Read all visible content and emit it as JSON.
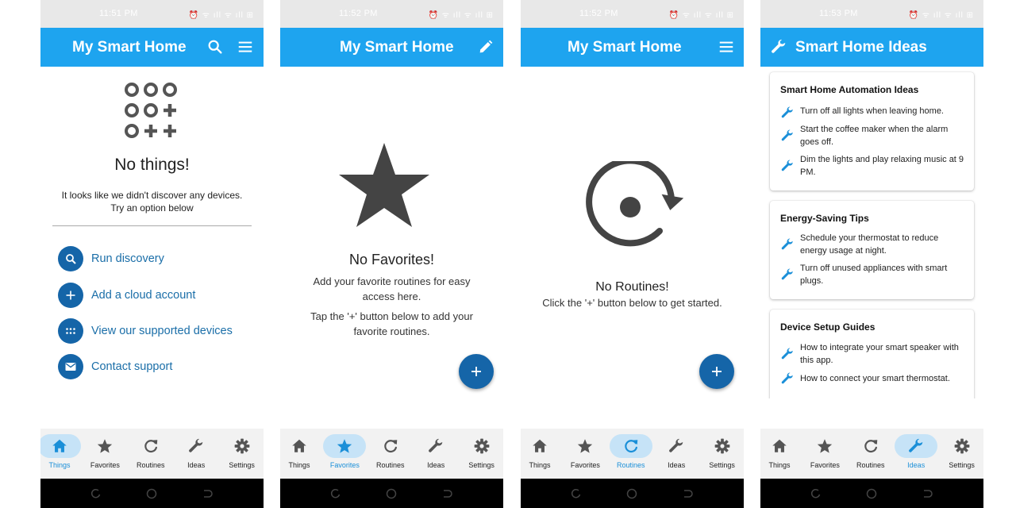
{
  "colors": {
    "primary": "#1ea4ef",
    "accent": "#1565a8",
    "active_nav_pill": "#c6e3f7"
  },
  "screens": [
    {
      "status_time": "11:51 PM",
      "status_icons": "⏰ ᯤ ıll ᯤ ıll ⊞",
      "title": "My Smart Home",
      "actions": [
        "search-icon",
        "menu-icon"
      ],
      "empty": {
        "title": "No things!",
        "line1": "It looks like we didn't discover any devices.",
        "line2": "Try an option below"
      },
      "options": [
        {
          "label": "Run discovery",
          "icon": "search-icon"
        },
        {
          "label": "Add a cloud account",
          "icon": "plus-icon"
        },
        {
          "label": "View our supported devices",
          "icon": "dots-grid-icon"
        },
        {
          "label": "Contact support",
          "icon": "mail-icon"
        }
      ],
      "active_tab": "Things"
    },
    {
      "status_time": "11:52 PM",
      "status_icons": "⏰ ᯤ ıll ᯤ ıll ⊞",
      "title": "My Smart Home",
      "actions": [
        "edit-icon"
      ],
      "empty": {
        "title": "No Favorites!",
        "line1": "Add your favorite routines for easy access here.",
        "line2": "Tap the '+' button below to add your favorite routines."
      },
      "active_tab": "Favorites"
    },
    {
      "status_time": "11:52 PM",
      "status_icons": "⏰ ᯤ ıll ᯤ ıll ⊞",
      "title": "My Smart Home",
      "actions": [
        "menu-icon"
      ],
      "empty": {
        "title": "No Routines!",
        "line1": "Click the '+' button below to get started."
      },
      "active_tab": "Routines"
    },
    {
      "status_time": "11:53 PM",
      "status_icons": "⏰ ᯤ ıll ᯤ ıll ⊞",
      "title": "Smart Home Ideas",
      "title_icon": "wrench-icon",
      "cards": [
        {
          "title": "Smart Home Automation Ideas",
          "items": [
            "Turn off all lights when leaving home.",
            "Start the coffee maker when the alarm goes off.",
            "Dim the lights and play relaxing music at 9 PM."
          ]
        },
        {
          "title": "Energy-Saving Tips",
          "items": [
            "Schedule your thermostat to reduce energy usage at night.",
            "Turn off unused appliances with smart plugs."
          ]
        },
        {
          "title": "Device Setup Guides",
          "items": [
            "How to integrate your smart speaker with this app.",
            "How to connect your smart thermostat."
          ]
        }
      ],
      "active_tab": "Ideas"
    }
  ],
  "nav_tabs": [
    {
      "label": "Things",
      "icon": "home-icon"
    },
    {
      "label": "Favorites",
      "icon": "star-icon"
    },
    {
      "label": "Routines",
      "icon": "refresh-icon"
    },
    {
      "label": "Ideas",
      "icon": "wrench-icon"
    },
    {
      "label": "Settings",
      "icon": "gear-icon"
    }
  ]
}
